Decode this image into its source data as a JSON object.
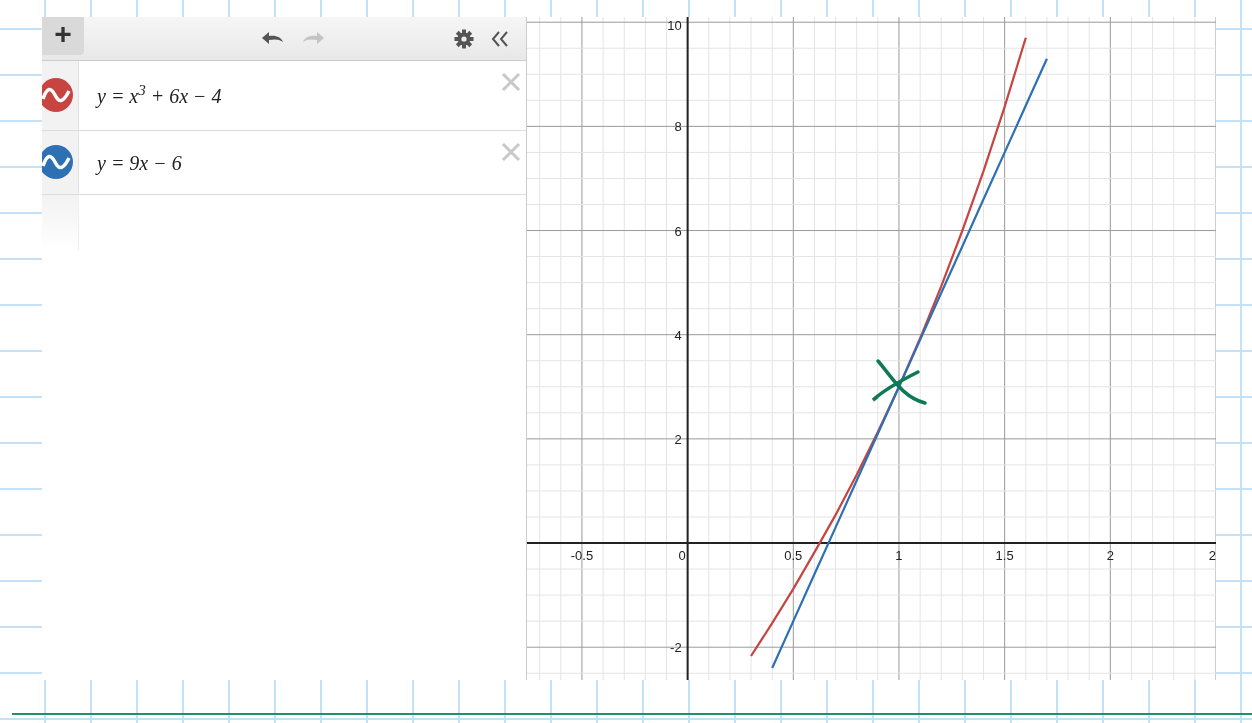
{
  "toolbar": {
    "add_label": "+",
    "undo_enabled": true,
    "redo_enabled": false
  },
  "expressions": [
    {
      "latex": "y = x$^{3}$ + 6x − 4",
      "color": "#c74440"
    },
    {
      "latex": "y = 9x − 6",
      "color": "#2d70b3"
    }
  ],
  "graph": {
    "chart_data": {
      "type": "line",
      "grid": true,
      "x": [
        0.3,
        0.4,
        0.5,
        0.6,
        0.7,
        0.8,
        0.9,
        1.0,
        1.1,
        1.2,
        1.3,
        1.4,
        1.5,
        1.6,
        1.7
      ],
      "series": [
        {
          "color": "#c74440",
          "values": [
            -2.17,
            -1.54,
            -0.88,
            -0.18,
            0.54,
            1.31,
            2.13,
            3.0,
            3.93,
            4.93,
            6.0,
            7.14,
            8.38,
            9.7,
            null
          ]
        },
        {
          "color": "#2d70b3",
          "values": [
            null,
            -2.4,
            -1.5,
            -0.6,
            0.3,
            1.2,
            2.1,
            3.0,
            3.9,
            4.8,
            5.7,
            6.6,
            7.5,
            8.4,
            9.3
          ]
        }
      ],
      "xlim": [
        -0.76,
        2.5
      ],
      "ylim": [
        -2.63,
        10.1
      ],
      "xticks": [
        {
          "value": -0.5,
          "label": "-0.5"
        },
        {
          "value": 0,
          "label": "0"
        },
        {
          "value": 0.5,
          "label": "0.5"
        },
        {
          "value": 1,
          "label": "1"
        },
        {
          "value": 1.5,
          "label": "1.5"
        },
        {
          "value": 2,
          "label": "2"
        },
        {
          "value": 2.5,
          "label": "2"
        }
      ],
      "yticks": [
        {
          "value": -2,
          "label": "-2"
        },
        {
          "value": 2,
          "label": "2"
        },
        {
          "value": 4,
          "label": "4"
        },
        {
          "value": 6,
          "label": "6"
        },
        {
          "value": 8,
          "label": "8"
        },
        {
          "value": 10,
          "label": "10"
        }
      ]
    }
  }
}
